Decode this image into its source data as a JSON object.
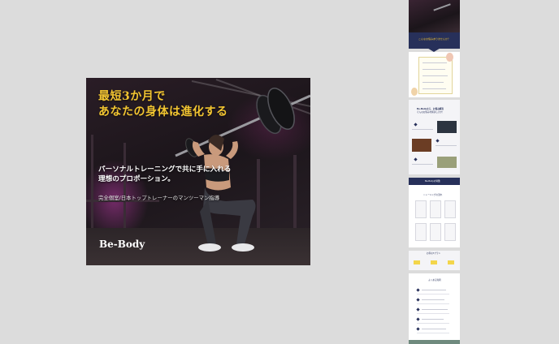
{
  "hero": {
    "headline_line1": "最短3か月で",
    "headline_line2": "あなたの身体は進化する",
    "tagline_line1": "パーソナルトレーニングで共に手に入れる",
    "tagline_line2": "理想のプロポーション。",
    "subline": "完全個室/日本トップトレーナーのマンツーマン指導",
    "logo": "Be-Body"
  },
  "thumbnail": {
    "banner_caption": "こんなお悩みありませんか？",
    "checklist_title": "こんなお悩み",
    "intro_title": "Be-Bodyなら、お悩み解消",
    "intro_subtitle": "そんなお悩みを解決します！",
    "features_title": "Be-Bodyの特徴",
    "steps_title": "トレーニングの流れ",
    "pricing_title": "お得な3プラン",
    "faq_title": "よくある質問"
  },
  "colors": {
    "accent_gold": "#f2c531",
    "navy": "#27305a",
    "magenta_glow": "#be3caa"
  }
}
